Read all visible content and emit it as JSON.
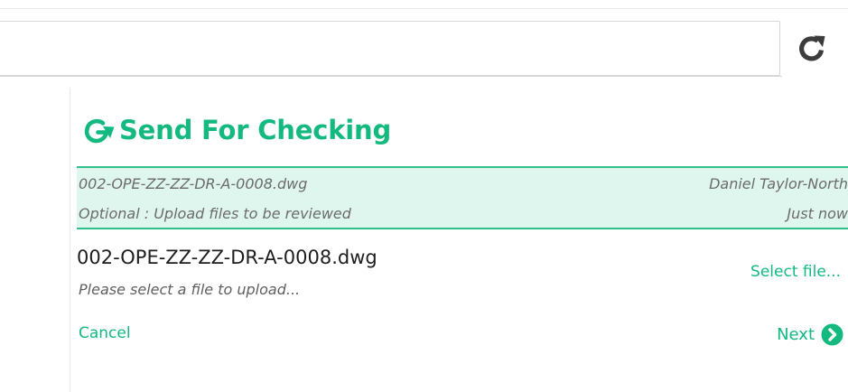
{
  "search": {
    "value": "",
    "placeholder": ""
  },
  "toolbar": {
    "refresh_icon": "refresh-icon"
  },
  "panel": {
    "title": "Send For Checking",
    "title_icon": "send-arrow-icon",
    "info": {
      "file_name": "002-OPE-ZZ-ZZ-DR-A-0008.dwg",
      "user": "Daniel Taylor-North",
      "description": "Optional : Upload files to be reviewed",
      "time": "Just now"
    },
    "upload": {
      "file_name": "002-OPE-ZZ-ZZ-DR-A-0008.dwg",
      "hint": "Please select a file to upload...",
      "select_label": "Select file..."
    },
    "actions": {
      "cancel_label": "Cancel",
      "next_label": "Next",
      "next_icon": "chevron-right-circle-icon"
    }
  },
  "colors": {
    "accent": "#13b97f",
    "band_background": "#dff6ef",
    "band_border": "#2fc08c",
    "muted_text": "#6b6b6b"
  }
}
